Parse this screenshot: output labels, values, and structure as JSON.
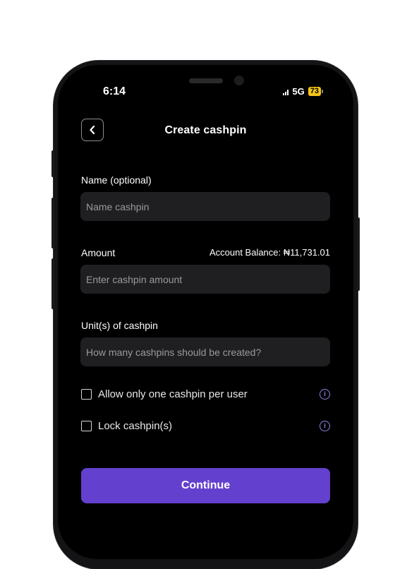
{
  "status_bar": {
    "time": "6:14",
    "network": "5G",
    "battery": "73"
  },
  "header": {
    "title": "Create cashpin",
    "back_icon": "chevron-left-icon"
  },
  "form": {
    "name_label": "Name (optional)",
    "name_placeholder": "Name cashpin",
    "amount_label": "Amount",
    "account_balance": "Account Balance: ₦11,731.01",
    "amount_placeholder": "Enter cashpin amount",
    "units_label": "Unit(s) of cashpin",
    "units_placeholder": "How many cashpins should be created?",
    "options": [
      {
        "label": "Allow only one cashpin per user",
        "checked": false,
        "info_icon": "info-icon"
      },
      {
        "label": "Lock cashpin(s)",
        "checked": false,
        "info_icon": "info-icon"
      }
    ]
  },
  "actions": {
    "continue_label": "Continue"
  },
  "colors": {
    "accent": "#6440cf",
    "info": "#8f83e8",
    "field_bg": "#1f1f22",
    "battery": "#f5c518"
  }
}
